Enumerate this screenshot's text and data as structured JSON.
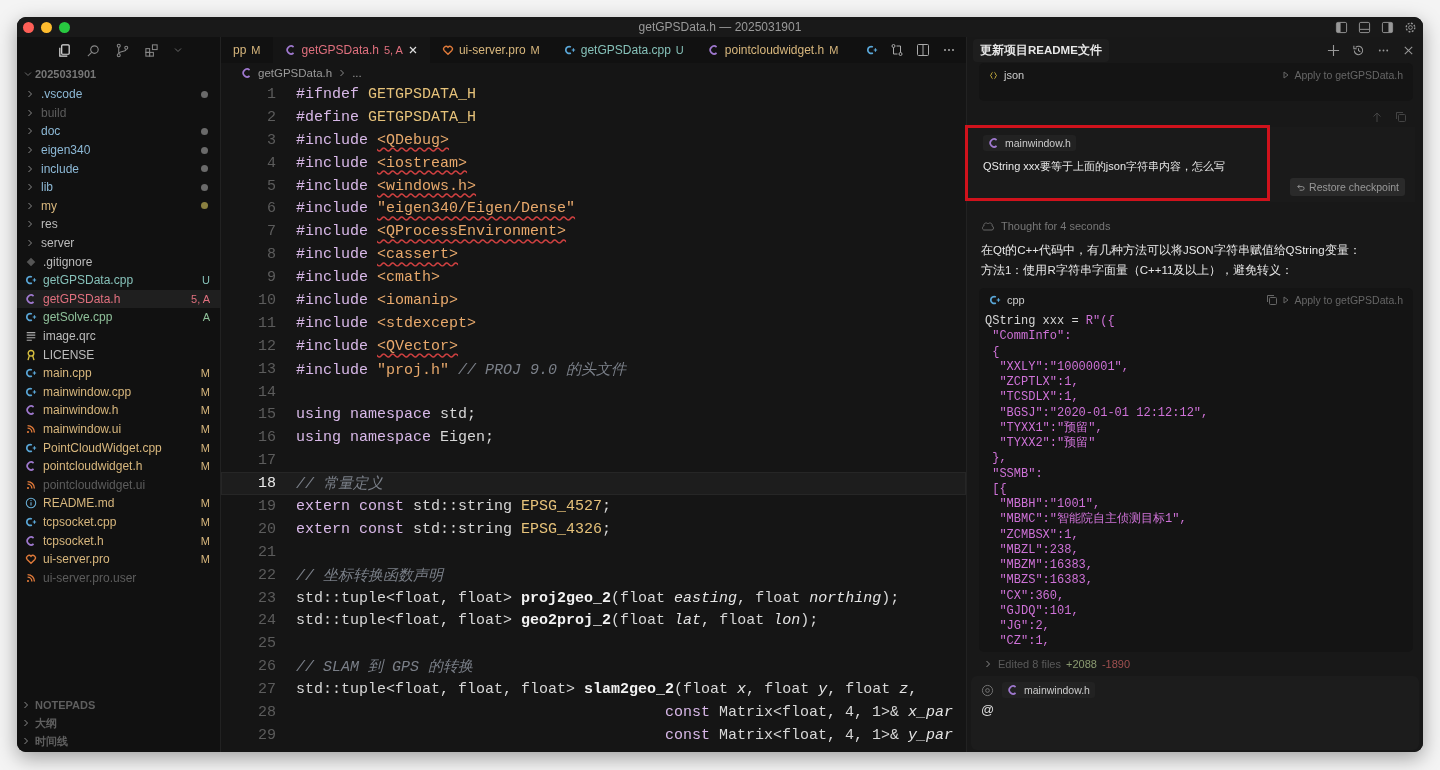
{
  "window": {
    "title": "getGPSData.h — 2025031901"
  },
  "explorer": {
    "root": "2025031901",
    "items": [
      {
        "name": ".vscode",
        "kind": "folder",
        "color": "#8db9d6",
        "dot": {
          "color": "#6a6a6a"
        },
        "selected": false
      },
      {
        "name": "build",
        "kind": "folder",
        "color": "#5d5d5d",
        "selected": false
      },
      {
        "name": "doc",
        "kind": "folder",
        "color": "#8db9d6",
        "dot": {
          "color": "#6a6a6a"
        },
        "selected": false
      },
      {
        "name": "eigen340",
        "kind": "folder",
        "color": "#8db9d6",
        "dot": {
          "color": "#6a6a6a"
        },
        "selected": false
      },
      {
        "name": "include",
        "kind": "folder",
        "color": "#8db9d6",
        "dot": {
          "color": "#6a6a6a"
        },
        "selected": false
      },
      {
        "name": "lib",
        "kind": "folder",
        "color": "#8db9d6",
        "dot": {
          "color": "#6a6a6a"
        },
        "selected": false
      },
      {
        "name": "my",
        "kind": "folder",
        "color": "#d8b77d",
        "dot": {
          "color": "#8a8040"
        },
        "selected": false
      },
      {
        "name": "res",
        "kind": "folder",
        "color": "#bcbcbc",
        "selected": false
      },
      {
        "name": "server",
        "kind": "folder",
        "color": "#bcbcbc",
        "selected": false
      },
      {
        "name": ".gitignore",
        "kind": "git",
        "color": "#bcbcbc",
        "selected": false
      },
      {
        "name": "getGPSData.cpp",
        "kind": "source",
        "color": "#86c1b9",
        "status": "U",
        "selected": false
      },
      {
        "name": "getGPSData.h",
        "kind": "header",
        "color": "#e0707e",
        "status": "5, A",
        "selected": true
      },
      {
        "name": "getSolve.cpp",
        "kind": "source",
        "color": "#8fc09a",
        "status": "A",
        "selected": false
      },
      {
        "name": "image.qrc",
        "kind": "resource",
        "color": "#bcbcbc",
        "selected": false
      },
      {
        "name": "LICENSE",
        "kind": "license",
        "color": "#bcbcbc",
        "selected": false
      },
      {
        "name": "main.cpp",
        "kind": "source",
        "color": "#d8b77d",
        "status": "M",
        "selected": false
      },
      {
        "name": "mainwindow.cpp",
        "kind": "source",
        "color": "#d8b77d",
        "status": "M",
        "selected": false
      },
      {
        "name": "mainwindow.h",
        "kind": "header",
        "color": "#d8b77d",
        "status": "M",
        "selected": false
      },
      {
        "name": "mainwindow.ui",
        "kind": "ui",
        "color": "#d8b77d",
        "status": "M",
        "selected": false
      },
      {
        "name": "PointCloudWidget.cpp",
        "kind": "source",
        "color": "#d8b77d",
        "status": "M",
        "selected": false
      },
      {
        "name": "pointcloudwidget.h",
        "kind": "header",
        "color": "#d8b77d",
        "status": "M",
        "selected": false
      },
      {
        "name": "pointcloudwidget.ui",
        "kind": "ui",
        "color": "#5d5d5d",
        "selected": false
      },
      {
        "name": "README.md",
        "kind": "info",
        "color": "#d8b77d",
        "status": "M",
        "selected": false
      },
      {
        "name": "tcpsocket.cpp",
        "kind": "source",
        "color": "#d8b77d",
        "status": "M",
        "selected": false
      },
      {
        "name": "tcpsocket.h",
        "kind": "header",
        "color": "#d8b77d",
        "status": "M",
        "selected": false
      },
      {
        "name": "ui-server.pro",
        "kind": "project",
        "color": "#d8b77d",
        "status": "M",
        "selected": false
      },
      {
        "name": "ui-server.pro.user",
        "kind": "ui",
        "color": "#5d5d5d",
        "selected": false
      }
    ]
  },
  "sections": [
    {
      "title": "NOTEPADS"
    },
    {
      "title": "大纲"
    },
    {
      "title": "时间线"
    }
  ],
  "editor": {
    "tabs": [
      {
        "label": "pp",
        "status": "M",
        "kind": "partial",
        "color": "#d8b77d",
        "selected": false
      },
      {
        "label": "getGPSData.h",
        "status": "5, A",
        "kind": "header",
        "color": "#e0707e",
        "selected": true
      },
      {
        "label": "ui-server.pro",
        "status": "M",
        "kind": "project",
        "color": "#d8b77d",
        "selected": false
      },
      {
        "label": "getGPSData.cpp",
        "status": "U",
        "kind": "source",
        "color": "#86c1b9",
        "selected": false
      },
      {
        "label": "pointcloudwidget.h",
        "status": "M",
        "kind": "header",
        "color": "#d8b77d",
        "selected": false
      }
    ],
    "breadcrumb": {
      "file": "getGPSData.h",
      "rest": "..."
    },
    "lines": [
      {
        "number": "1",
        "current": false,
        "tokens": [
          {
            "kind": "directive",
            "text": "#ifndef "
          },
          {
            "kind": "macro",
            "text": "GETGPSDATA_H"
          }
        ]
      },
      {
        "number": "2",
        "current": false,
        "tokens": [
          {
            "kind": "directive",
            "text": "#define "
          },
          {
            "kind": "macro",
            "text": "GETGPSDATA_H"
          }
        ]
      },
      {
        "number": "3",
        "current": false,
        "tokens": [
          {
            "kind": "directive",
            "text": "#include "
          },
          {
            "kind": "string",
            "text": "<QDebug>",
            "squiggle": true
          }
        ]
      },
      {
        "number": "4",
        "current": false,
        "tokens": [
          {
            "kind": "directive",
            "text": "#include "
          },
          {
            "kind": "string",
            "text": "<iostream>",
            "squiggle": true
          }
        ]
      },
      {
        "number": "5",
        "current": false,
        "tokens": [
          {
            "kind": "directive",
            "text": "#include "
          },
          {
            "kind": "string",
            "text": "<windows.h>",
            "squiggle": true
          }
        ]
      },
      {
        "number": "6",
        "current": false,
        "tokens": [
          {
            "kind": "directive",
            "text": "#include "
          },
          {
            "kind": "string",
            "text": "\"eigen340/Eigen/Dense\"",
            "squiggle": true
          }
        ]
      },
      {
        "number": "7",
        "current": false,
        "tokens": [
          {
            "kind": "directive",
            "text": "#include "
          },
          {
            "kind": "string",
            "text": "<QProcessEnvironment>",
            "squiggle": true
          }
        ]
      },
      {
        "number": "8",
        "current": false,
        "tokens": [
          {
            "kind": "directive",
            "text": "#include "
          },
          {
            "kind": "string",
            "text": "<cassert>",
            "squiggle": true
          }
        ]
      },
      {
        "number": "9",
        "current": false,
        "tokens": [
          {
            "kind": "directive",
            "text": "#include "
          },
          {
            "kind": "string",
            "text": "<cmath>",
            "squiggle": false
          }
        ]
      },
      {
        "number": "10",
        "current": false,
        "tokens": [
          {
            "kind": "directive",
            "text": "#include "
          },
          {
            "kind": "string",
            "text": "<iomanip>",
            "squiggle": false
          }
        ]
      },
      {
        "number": "11",
        "current": false,
        "tokens": [
          {
            "kind": "directive",
            "text": "#include "
          },
          {
            "kind": "string",
            "text": "<stdexcept>",
            "squiggle": false
          }
        ]
      },
      {
        "number": "12",
        "current": false,
        "tokens": [
          {
            "kind": "directive",
            "text": "#include "
          },
          {
            "kind": "string",
            "text": "<QVector>",
            "squiggle": true
          }
        ]
      },
      {
        "number": "13",
        "current": false,
        "tokens": [
          {
            "kind": "directive",
            "text": "#include "
          },
          {
            "kind": "string",
            "text": "\"proj.h\""
          },
          {
            "kind": "comment",
            "text": " // PROJ 9.0 的头文件"
          }
        ]
      },
      {
        "number": "14",
        "current": false
      },
      {
        "number": "15",
        "current": false,
        "tokens": [
          {
            "kind": "keyword",
            "text": "using namespace "
          },
          {
            "kind": "plain",
            "text": "std;"
          }
        ]
      },
      {
        "number": "16",
        "current": false,
        "tokens": [
          {
            "kind": "keyword",
            "text": "using namespace "
          },
          {
            "kind": "plain",
            "text": "Eigen;"
          }
        ]
      },
      {
        "number": "17",
        "current": false
      },
      {
        "number": "18",
        "current": true,
        "tokens": [
          {
            "kind": "comment",
            "text": "// 常量定义"
          }
        ]
      },
      {
        "number": "19",
        "current": false,
        "tokens": [
          {
            "kind": "keyword",
            "text": "extern const "
          },
          {
            "kind": "type",
            "text": "std::string "
          },
          {
            "kind": "macro",
            "text": "EPSG_4527"
          },
          {
            "kind": "plain",
            "text": ";"
          }
        ]
      },
      {
        "number": "20",
        "current": false,
        "tokens": [
          {
            "kind": "keyword",
            "text": "extern const "
          },
          {
            "kind": "type",
            "text": "std::string "
          },
          {
            "kind": "macro",
            "text": "EPSG_4326"
          },
          {
            "kind": "plain",
            "text": ";"
          }
        ]
      },
      {
        "number": "21",
        "current": false
      },
      {
        "number": "22",
        "current": false,
        "tokens": [
          {
            "kind": "comment",
            "text": "// 坐标转换函数声明"
          }
        ]
      },
      {
        "number": "23",
        "current": false,
        "tokens": [
          {
            "kind": "type",
            "text": "std::tuple<float, float> "
          },
          {
            "kind": "fn",
            "text": "proj2geo_2"
          },
          {
            "kind": "plain",
            "text": "("
          },
          {
            "kind": "type",
            "text": "float "
          },
          {
            "kind": "param",
            "text": "easting"
          },
          {
            "kind": "plain",
            "text": ", "
          },
          {
            "kind": "type",
            "text": "float "
          },
          {
            "kind": "param",
            "text": "northing"
          },
          {
            "kind": "plain",
            "text": ");"
          }
        ]
      },
      {
        "number": "24",
        "current": false,
        "tokens": [
          {
            "kind": "type",
            "text": "std::tuple<float, float> "
          },
          {
            "kind": "fn",
            "text": "geo2proj_2"
          },
          {
            "kind": "plain",
            "text": "("
          },
          {
            "kind": "type",
            "text": "float "
          },
          {
            "kind": "param",
            "text": "lat"
          },
          {
            "kind": "plain",
            "text": ", "
          },
          {
            "kind": "type",
            "text": "float "
          },
          {
            "kind": "param",
            "text": "lon"
          },
          {
            "kind": "plain",
            "text": ");"
          }
        ]
      },
      {
        "number": "25",
        "current": false
      },
      {
        "number": "26",
        "current": false,
        "tokens": [
          {
            "kind": "comment",
            "text": "// SLAM 到 GPS 的转换"
          }
        ]
      },
      {
        "number": "27",
        "current": false,
        "tokens": [
          {
            "kind": "type",
            "text": "std::tuple<float, float, float> "
          },
          {
            "kind": "fn",
            "text": "slam2geo_2"
          },
          {
            "kind": "plain",
            "text": "("
          },
          {
            "kind": "type",
            "text": "float "
          },
          {
            "kind": "param",
            "text": "x"
          },
          {
            "kind": "plain",
            "text": ", "
          },
          {
            "kind": "type",
            "text": "float "
          },
          {
            "kind": "param",
            "text": "y"
          },
          {
            "kind": "plain",
            "text": ", "
          },
          {
            "kind": "type",
            "text": "float "
          },
          {
            "kind": "param",
            "text": "z"
          },
          {
            "kind": "plain",
            "text": ","
          }
        ]
      },
      {
        "number": "28",
        "current": false,
        "tokens": [
          {
            "kind": "keyword",
            "text": "                                         const "
          },
          {
            "kind": "type",
            "text": "Matrix<float, 4, 1>& "
          },
          {
            "kind": "param",
            "text": "x_par"
          }
        ]
      },
      {
        "number": "29",
        "current": false,
        "tokens": [
          {
            "kind": "keyword",
            "text": "                                         const "
          },
          {
            "kind": "type",
            "text": "Matrix<float, 4, 1>& "
          },
          {
            "kind": "param",
            "text": "y_par"
          }
        ]
      }
    ]
  },
  "chat": {
    "title": "更新项目README文件",
    "prev_block": {
      "language": "json",
      "apply": "Apply to getGPSData.h"
    },
    "user_message": {
      "context_file": "mainwindow.h",
      "text": "QString xxx要等于上面的json字符串内容，怎么写",
      "highlighted": true,
      "restore": "Restore checkpoint"
    },
    "thought": "Thought for 4 seconds",
    "paragraphs": [
      "在Qt的C++代码中，有几种方法可以将JSON字符串赋值给QString变量：",
      "方法1：使用R字符串字面量（C++11及以上），避免转义："
    ],
    "code_block": {
      "language": "cpp",
      "apply": "Apply to getGPSData.h",
      "lines": [
        [
          {
            "kind": "plain",
            "text": "QString xxx = "
          },
          {
            "kind": "literal",
            "text": "R\"({"
          }
        ],
        [
          {
            "kind": "literal",
            "text": " \"CommInfo\":"
          }
        ],
        [
          {
            "kind": "literal",
            "text": " {"
          }
        ],
        [
          {
            "kind": "literal",
            "text": "  \"XXLY\":\"10000001\","
          }
        ],
        [
          {
            "kind": "literal",
            "text": "  \"ZCPTLX\":1,"
          }
        ],
        [
          {
            "kind": "literal",
            "text": "  \"TCSDLX\":1,"
          }
        ],
        [
          {
            "kind": "literal",
            "text": "  \"BGSJ\":\"2020-01-01 12:12:12\","
          }
        ],
        [
          {
            "kind": "literal",
            "text": "  \"TYXX1\":\"预留\","
          }
        ],
        [
          {
            "kind": "literal",
            "text": "  \"TYXX2\":\"预留\""
          }
        ],
        [
          {
            "kind": "literal",
            "text": " },"
          }
        ],
        [
          {
            "kind": "literal",
            "text": " \"SSMB\":"
          }
        ],
        [
          {
            "kind": "literal",
            "text": " [{"
          }
        ],
        [
          {
            "kind": "literal",
            "text": "  \"MBBH\":\"1001\","
          }
        ],
        [
          {
            "kind": "literal",
            "text": "  \"MBMC\":\"智能院自主侦测目标1\","
          }
        ],
        [
          {
            "kind": "literal",
            "text": "  \"ZCMBSX\":1,"
          }
        ],
        [
          {
            "kind": "literal",
            "text": "  \"MBZL\":238,"
          }
        ],
        [
          {
            "kind": "literal",
            "text": "  \"MBZM\":16383,"
          }
        ],
        [
          {
            "kind": "literal",
            "text": "  \"MBZS\":16383,"
          }
        ],
        [
          {
            "kind": "literal",
            "text": "  \"CX\":360,"
          }
        ],
        [
          {
            "kind": "literal",
            "text": "  \"GJDQ\":101,"
          }
        ],
        [
          {
            "kind": "literal",
            "text": "  \"JG\":2,"
          }
        ],
        [
          {
            "kind": "literal",
            "text": "  \"CZ\":1,"
          }
        ]
      ]
    },
    "edited": {
      "label": "Edited 8 files",
      "added": "+2088",
      "removed": "-1890"
    },
    "composer": {
      "context_file": "mainwindow.h",
      "value": "@"
    }
  }
}
